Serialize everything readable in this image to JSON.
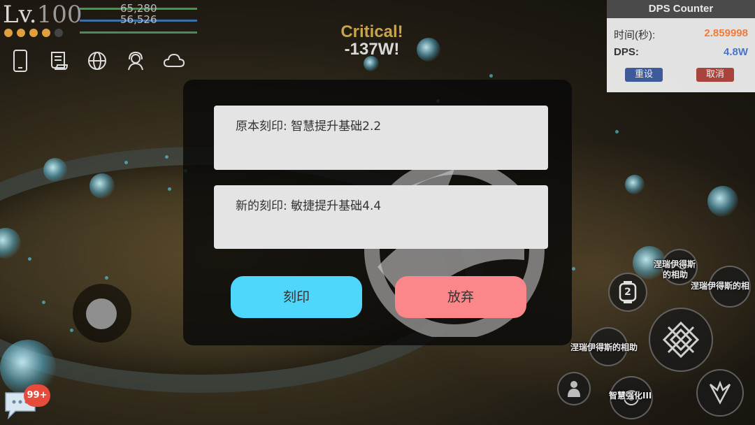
{
  "hud": {
    "level_prefix": "Lv.",
    "level": "100",
    "stars_filled": 4,
    "stars_total": 5,
    "hp": "65,280",
    "mp": "56,526",
    "icons": [
      "phone-icon",
      "scroll-icon",
      "globe-icon",
      "support-icon",
      "cloud-icon"
    ]
  },
  "combat": {
    "critical_label": "Critical!",
    "damage": "-137W!"
  },
  "dps_counter": {
    "title": "DPS Counter",
    "time_label": "时间(秒):",
    "time_value": "2.859998",
    "dps_label": "DPS:",
    "dps_value": "4.8W",
    "reset_label": "重设",
    "cancel_label": "取消",
    "colors": {
      "time_value": "#f07b3a",
      "dps_value": "#4a72c8",
      "reset": "#3e5a9a",
      "cancel": "#a8443d"
    }
  },
  "dialog": {
    "original_label": "原本刻印: 智慧提升基础2.2",
    "new_label": "新的刻印: 敏捷提升基础4.4",
    "engrave_button": "刻印",
    "discard_button": "放弃",
    "colors": {
      "engrave": "#4fd6fb",
      "discard": "#fb878a"
    }
  },
  "skills": {
    "skill_a_label_line1": "涅瑞伊得斯",
    "skill_a_label_line2": "的相助",
    "skill_b_label": "涅瑞伊得斯的相",
    "skill_c_label": "涅瑞伊得斯的相助",
    "skill_d_label": "智慧强化III",
    "slot_number": "2"
  },
  "chat": {
    "badge": "99+"
  }
}
